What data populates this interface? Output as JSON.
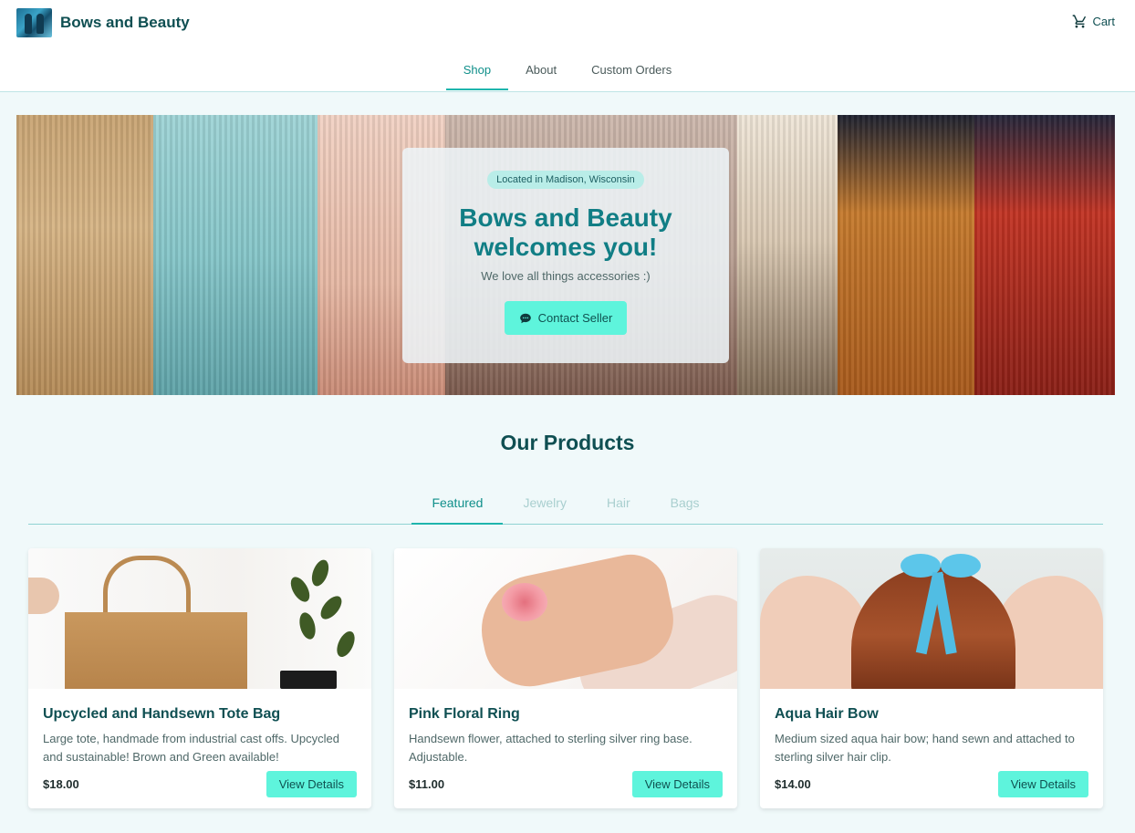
{
  "header": {
    "brand_name": "Bows and Beauty",
    "cart_label": "Cart",
    "nav": [
      "Shop",
      "About",
      "Custom Orders"
    ],
    "active_nav": "Shop"
  },
  "hero": {
    "location_badge": "Located in Madison, Wisconsin",
    "title_line1": "Bows and Beauty",
    "title_line2": "welcomes you!",
    "subtitle": "We love all things accessories :)",
    "contact_button": "Contact Seller"
  },
  "products_section": {
    "title": "Our Products",
    "tabs": [
      "Featured",
      "Jewelry",
      "Hair",
      "Bags"
    ],
    "active_tab": "Featured",
    "items": [
      {
        "title": "Upcycled and Handsewn Tote Bag",
        "description": "Large tote, handmade from industrial cast offs. Upcycled and sustainable! Brown and Green available!",
        "price": "$18.00",
        "button": "View Details"
      },
      {
        "title": "Pink Floral Ring",
        "description": "Handsewn flower, attached to sterling silver ring base. Adjustable.",
        "price": "$11.00",
        "button": "View Details"
      },
      {
        "title": "Aqua Hair Bow",
        "description": "Medium sized aqua hair bow; hand sewn and attached to sterling silver hair clip.",
        "price": "$14.00",
        "button": "View Details"
      }
    ]
  },
  "icons": {
    "cart": "cart-icon",
    "contact": "chat-bubble-icon"
  },
  "colors": {
    "accent": "#5ef4dc",
    "brand_text": "#0f4f52",
    "active_tab": "#0f8f8a",
    "page_background": "#f0f9fa"
  }
}
